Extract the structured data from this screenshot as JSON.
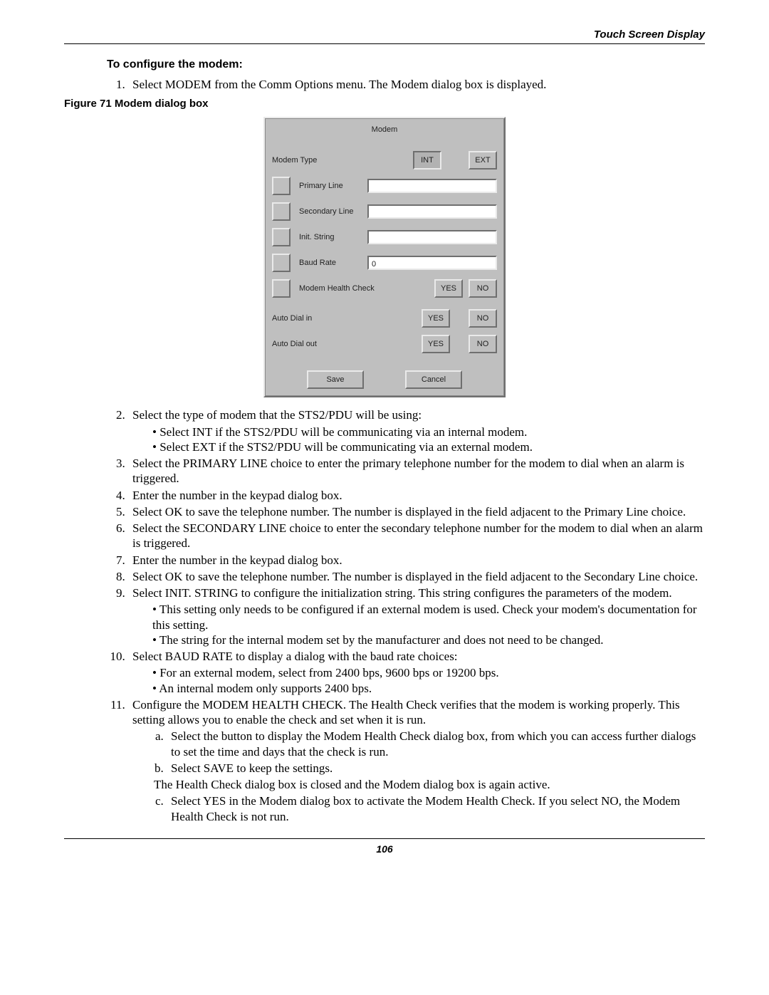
{
  "header": {
    "right": "Touch Screen Display"
  },
  "section_title": "To configure the modem:",
  "figure_caption": "Figure 71  Modem dialog box",
  "dialog": {
    "title": "Modem",
    "modem_type_label": "Modem Type",
    "btn_int": "INT",
    "btn_ext": "EXT",
    "primary_line_label": "Primary Line",
    "primary_line_value": "",
    "secondary_line_label": "Secondary Line",
    "secondary_line_value": "",
    "init_string_label": "Init. String",
    "init_string_value": "",
    "baud_rate_label": "Baud Rate",
    "baud_rate_value": "0",
    "health_label": "Modem Health Check",
    "auto_in_label": "Auto Dial in",
    "auto_out_label": "Auto Dial out",
    "yes": "YES",
    "no": "NO",
    "save": "Save",
    "cancel": "Cancel"
  },
  "steps": {
    "s1": "Select MODEM from the Comm Options menu. The Modem dialog box is displayed.",
    "s2": "Select the type of modem that the STS2/PDU will be using:",
    "s2a": "Select INT if the STS2/PDU will be communicating via an internal modem.",
    "s2b": "Select EXT if the STS2/PDU will be communicating via an external modem.",
    "s3": "Select the PRIMARY LINE choice to enter the primary telephone number for the modem to dial when an alarm is triggered.",
    "s4": "Enter the number in the keypad dialog box.",
    "s5": "Select OK to save the telephone number. The number is displayed in the field adjacent to the Primary Line choice.",
    "s6": "Select the SECONDARY LINE choice to enter the secondary telephone number for the modem to dial when an alarm is triggered.",
    "s7": "Enter the number in the keypad dialog box.",
    "s8": "Select OK to save the telephone number. The number is displayed in the field adjacent to the Secondary Line choice.",
    "s9": "Select INIT. STRING to configure the initialization string. This string configures the parameters of the modem.",
    "s9a": "This setting only needs to be configured if an external modem is used. Check your modem's documentation for this setting.",
    "s9b": "The string for the internal modem set by the manufacturer and does not need to be changed.",
    "s10": "Select BAUD RATE to display a dialog with the baud rate choices:",
    "s10a": "For an external modem, select from 2400 bps, 9600 bps or 19200 bps.",
    "s10b": "An internal modem only supports 2400 bps.",
    "s11": "Configure the MODEM HEALTH CHECK. The Health Check verifies that the modem is working properly. This setting allows you to enable the check and set when it is run.",
    "s11a": "Select the button to display the Modem Health Check dialog box, from which you can access further dialogs to set the time and days that the check is run.",
    "s11b": "Select SAVE to keep the settings.",
    "s11note": "The Health Check dialog box is closed and the Modem dialog box is again active.",
    "s11c": "Select YES in the Modem dialog box to activate the Modem Health Check. If you select NO, the Modem Health Check is not run."
  },
  "page_number": "106"
}
